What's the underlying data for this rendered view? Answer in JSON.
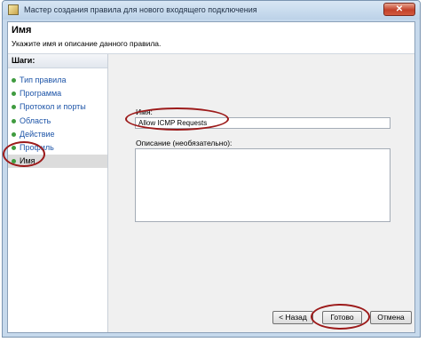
{
  "window": {
    "title": "Мастер создания правила для нового входящего подключения",
    "close_glyph": "✕"
  },
  "header": {
    "title": "Имя",
    "subtitle": "Укажите имя и описание данного правила."
  },
  "sidebar": {
    "heading": "Шаги:",
    "items": [
      {
        "label": "Тип правила",
        "active": false
      },
      {
        "label": "Программа",
        "active": false
      },
      {
        "label": "Протокол и порты",
        "active": false
      },
      {
        "label": "Область",
        "active": false
      },
      {
        "label": "Действие",
        "active": false
      },
      {
        "label": "Профиль",
        "active": false
      },
      {
        "label": "Имя",
        "active": true
      }
    ]
  },
  "form": {
    "name_label": "Имя:",
    "name_value": "Allow ICMP Requests",
    "description_label": "Описание (необязательно):",
    "description_value": ""
  },
  "buttons": {
    "back": "< Назад",
    "finish": "Готово",
    "cancel": "Отмена"
  },
  "colors": {
    "highlight_ring": "#9c1a1a",
    "step_link": "#1e55a8",
    "step_dot": "#3f9b3f"
  },
  "icons": {
    "app": "wizard-app-icon",
    "close": "close-icon"
  }
}
